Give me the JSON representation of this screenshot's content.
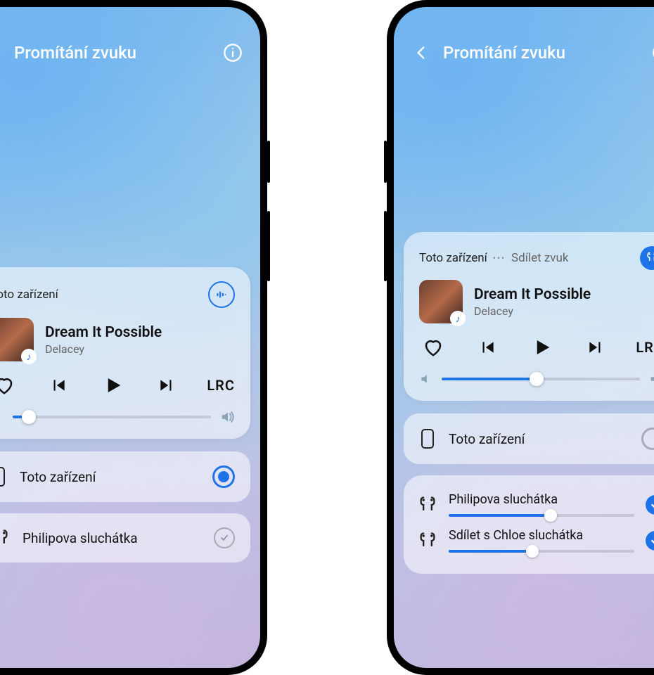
{
  "header": {
    "title": "Promítání zvuku"
  },
  "player": {
    "tabs": {
      "this_device": "Toto zařízení",
      "share_audio": "Sdílet zvuk"
    },
    "track_title": "Dream It Possible",
    "track_artist": "Delacey",
    "lrc_label": "LRC"
  },
  "left": {
    "volume_percent": 8,
    "device1": "Toto zařízení",
    "device2": "Philipova sluchátka"
  },
  "right": {
    "volume_percent": 48,
    "device_this": "Toto zařízení",
    "share1": {
      "name": "Philipova sluchátka",
      "volume_percent": 55
    },
    "share2": {
      "name": "Sdílet s Chloe sluchátka",
      "volume_percent": 45
    }
  }
}
